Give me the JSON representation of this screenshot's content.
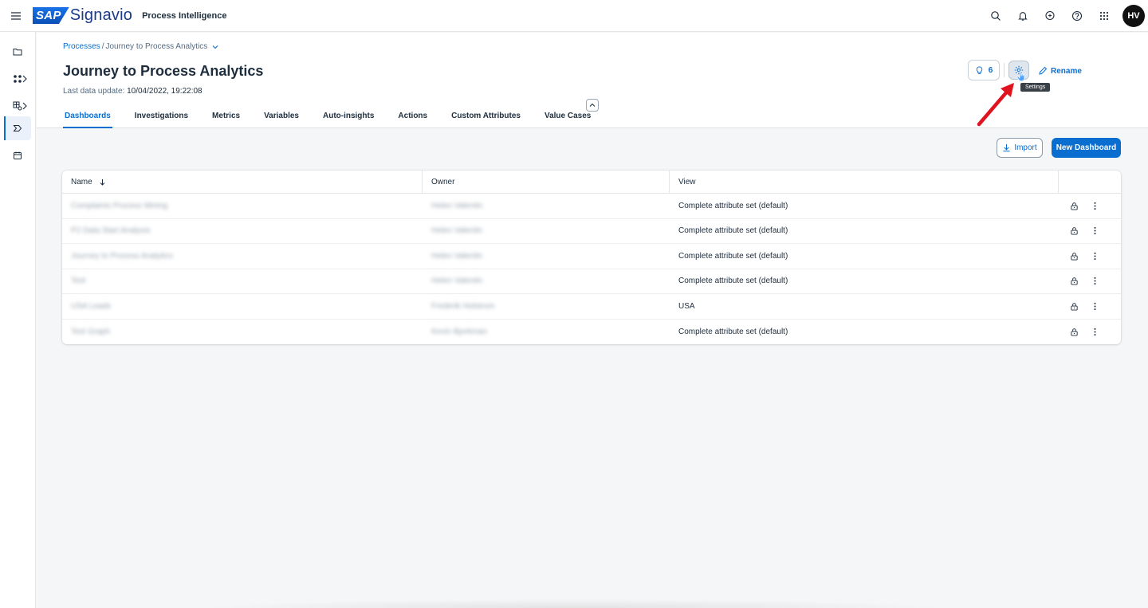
{
  "shell": {
    "brand_sap": "SAP",
    "brand_signavio": "Signavio",
    "product": "Process Intelligence",
    "avatar_initials": "HV",
    "icons": [
      "search-icon",
      "bell-icon",
      "feedback-icon",
      "help-icon",
      "app-grid-icon"
    ]
  },
  "sidenav": {
    "items": [
      {
        "icon": "folder-icon"
      },
      {
        "icon": "process-icon",
        "has_chevron": true
      },
      {
        "icon": "data-icon",
        "has_chevron": true
      },
      {
        "icon": "dashboard-nav-icon",
        "active": true
      },
      {
        "icon": "calendar-icon"
      }
    ]
  },
  "header": {
    "breadcrumb_root": "Processes",
    "breadcrumb_sep": "/",
    "breadcrumb_current": "Journey to Process Analytics",
    "title": "Journey to Process Analytics",
    "last_update_label": "Last data update:",
    "last_update_value": "10/04/2022, 19:22:08",
    "insight_count": "6",
    "settings_tooltip": "Settings",
    "rename_label": "Rename",
    "tabs": [
      {
        "label": "Dashboards",
        "active": true
      },
      {
        "label": "Investigations"
      },
      {
        "label": "Metrics"
      },
      {
        "label": "Variables"
      },
      {
        "label": "Auto-insights"
      },
      {
        "label": "Actions"
      },
      {
        "label": "Custom Attributes"
      },
      {
        "label": "Value Cases"
      }
    ]
  },
  "toolbar": {
    "import_label": "Import",
    "new_dashboard_label": "New Dashboard"
  },
  "table": {
    "columns": {
      "name": "Name",
      "owner": "Owner",
      "view": "View"
    },
    "rows": [
      {
        "name": "Complaints Process Mining",
        "owner": "Helen Valentin",
        "view": "Complete attribute set (default)"
      },
      {
        "name": "P2 Data Start Analysis",
        "owner": "Helen Valentin",
        "view": "Complete attribute set (default)"
      },
      {
        "name": "Journey to Process Analytics",
        "owner": "Helen Valentin",
        "view": "Complete attribute set (default)"
      },
      {
        "name": "Test",
        "owner": "Helen Valentin",
        "view": "Complete attribute set (default)"
      },
      {
        "name": "USA Leads",
        "owner": "Frederik Holstrom",
        "view": "USA"
      },
      {
        "name": "Test Graph",
        "owner": "Kevin Bjorkman",
        "view": "Complete attribute set (default)"
      }
    ]
  },
  "colors": {
    "accent": "#0a6ed1",
    "annotation_arrow": "#e0141e"
  }
}
